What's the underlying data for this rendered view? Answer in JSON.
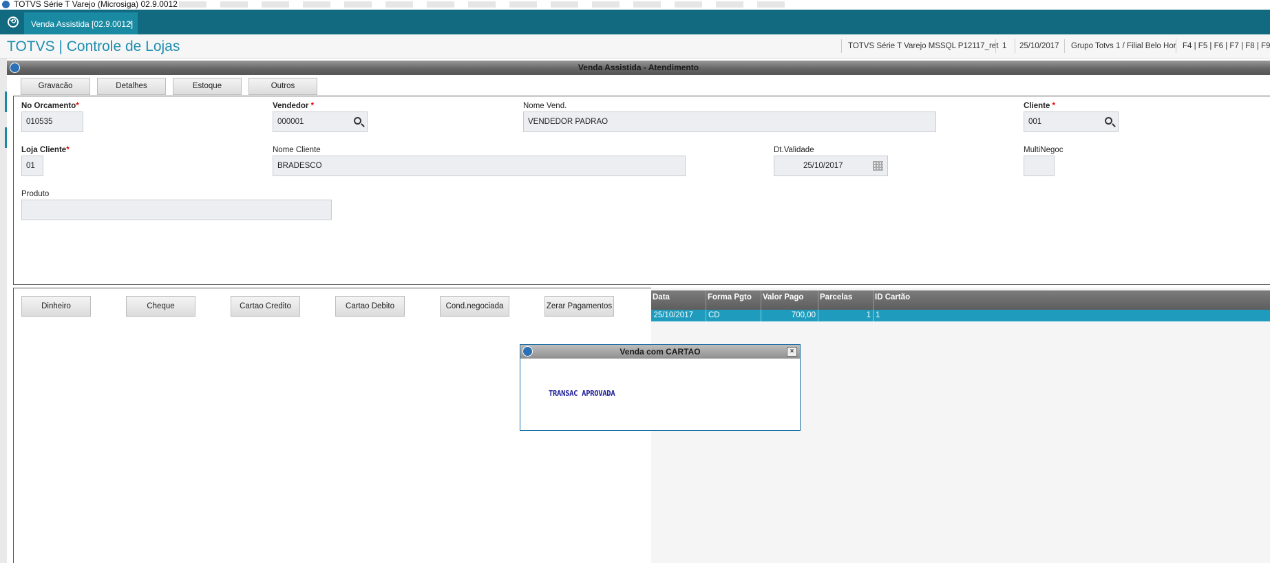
{
  "window": {
    "title": "TOTVS Série T Varejo (Microsiga) 02.9.0012"
  },
  "tab": {
    "label": "Venda Assistida [02.9.0012]",
    "close": "×"
  },
  "header": {
    "brand": "TOTVS | Controle de Lojas",
    "env": "TOTVS Série T Varejo MSSQL P12117_ret",
    "user": "1",
    "date": "25/10/2017",
    "branch": "Grupo Totvs 1 / Filial Belo Hor",
    "shortcuts": "F4 | F5 | F6 | F7 | F8 | F9 | F"
  },
  "main_window": {
    "title": "Venda Assistida - Atendimento"
  },
  "toolbar": {
    "gravacao": "Gravacão",
    "detalhes": "Detalhes",
    "estoque": "Estoque",
    "outros": "Outros"
  },
  "form": {
    "orcamento_label": "No Orcamento",
    "orcamento_value": "010535",
    "vendedor_label": "Vendedor",
    "vendedor_value": "000001",
    "nome_vend_label": "Nome Vend.",
    "nome_vend_value": "VENDEDOR PADRAO",
    "cliente_label": "Cliente",
    "cliente_value": "001",
    "loja_label": "Loja Cliente",
    "loja_value": "01",
    "nome_cliente_label": "Nome Cliente",
    "nome_cliente_value": "BRADESCO",
    "validade_label": "Dt.Validade",
    "validade_value": "25/10/2017",
    "multinegoc_label": "MultiNegoc",
    "multinegoc_value": "",
    "produto_label": "Produto",
    "produto_value": "",
    "required_mark": "*"
  },
  "payments": {
    "dinheiro": "Dinheiro",
    "cheque": "Cheque",
    "cartao_credito": "Cartao Credito",
    "cartao_debito": "Cartao Debito",
    "cond_negociada": "Cond.negociada",
    "zerar": "Zerar Pagamentos"
  },
  "grid": {
    "columns": [
      "Data",
      "Forma Pgto",
      "Valor Pago",
      "Parcelas",
      "ID Cartão"
    ],
    "rows": [
      {
        "data": "25/10/2017",
        "forma": "CD",
        "valor": "700,00",
        "parcelas": "1",
        "id_cartao": "1"
      }
    ]
  },
  "dialog": {
    "title": "Venda com CARTAO",
    "message": "TRANSAC APROVADA",
    "close": "×"
  },
  "colors": {
    "accent": "#116a80",
    "brand": "#1e8eb0",
    "selected_row": "#1f9cbd"
  }
}
